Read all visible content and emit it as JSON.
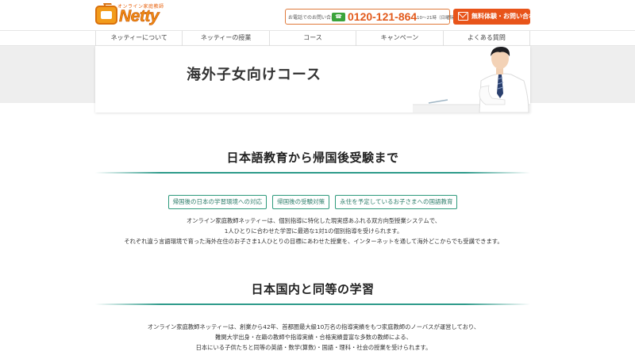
{
  "header": {
    "logo": {
      "tagline": "オンライン家庭教師",
      "brand": "Netty"
    },
    "phone": {
      "lead": "お電話でのお問い合わせ",
      "icon_label": "0120",
      "number": "0120-121-864",
      "hours": "10～21時（日曜除く）"
    },
    "cta": {
      "label": "無料体験・お問い合わせ",
      "color": "#e8541a"
    }
  },
  "nav": {
    "items": [
      {
        "label": "ネッティーについて"
      },
      {
        "label": "ネッティーの授業"
      },
      {
        "label": "コース"
      },
      {
        "label": "キャンペーン"
      },
      {
        "label": "よくある質問"
      }
    ]
  },
  "hero": {
    "title": "海外子女向けコース"
  },
  "section1": {
    "title": "日本語教育から帰国後受験まで",
    "tags": [
      {
        "label": "帰国後の日本の学習環境への対応"
      },
      {
        "label": "帰国後の受験対策"
      },
      {
        "label": "永住を予定しているお子さまへの国語教育"
      }
    ],
    "paragraph": [
      "オンライン家庭教師ネッティーは、個別指導に特化した現実感あふれる双方向型授業システムで、",
      "1人ひとりに合わせた学習に最適な1対1の個別指導を受けられます。",
      "それぞれ違う言語環境で育った海外在住のお子さま1人ひとりの目標にあわせた授業を、インターネットを通して海外どこからでも受講できます。"
    ]
  },
  "section2": {
    "title": "日本国内と同等の学習",
    "paragraph": [
      "オンライン家庭教師ネッティーは、創業から42年、首都圏最大級10万名の指導実績をもつ家庭教師のノーバスが運営しており、",
      "難関大学出身・在籍の教師や指導実績・合格実績豊富な多数の教師による、",
      "日本にいる子供たちと同等の英語・数学(算数)・国語・理科・社会の授業を受けられます。"
    ]
  },
  "colors": {
    "accent": "#2d9a8a",
    "brand_orange": "#f08a12",
    "phone_orange": "#e25a1c"
  }
}
